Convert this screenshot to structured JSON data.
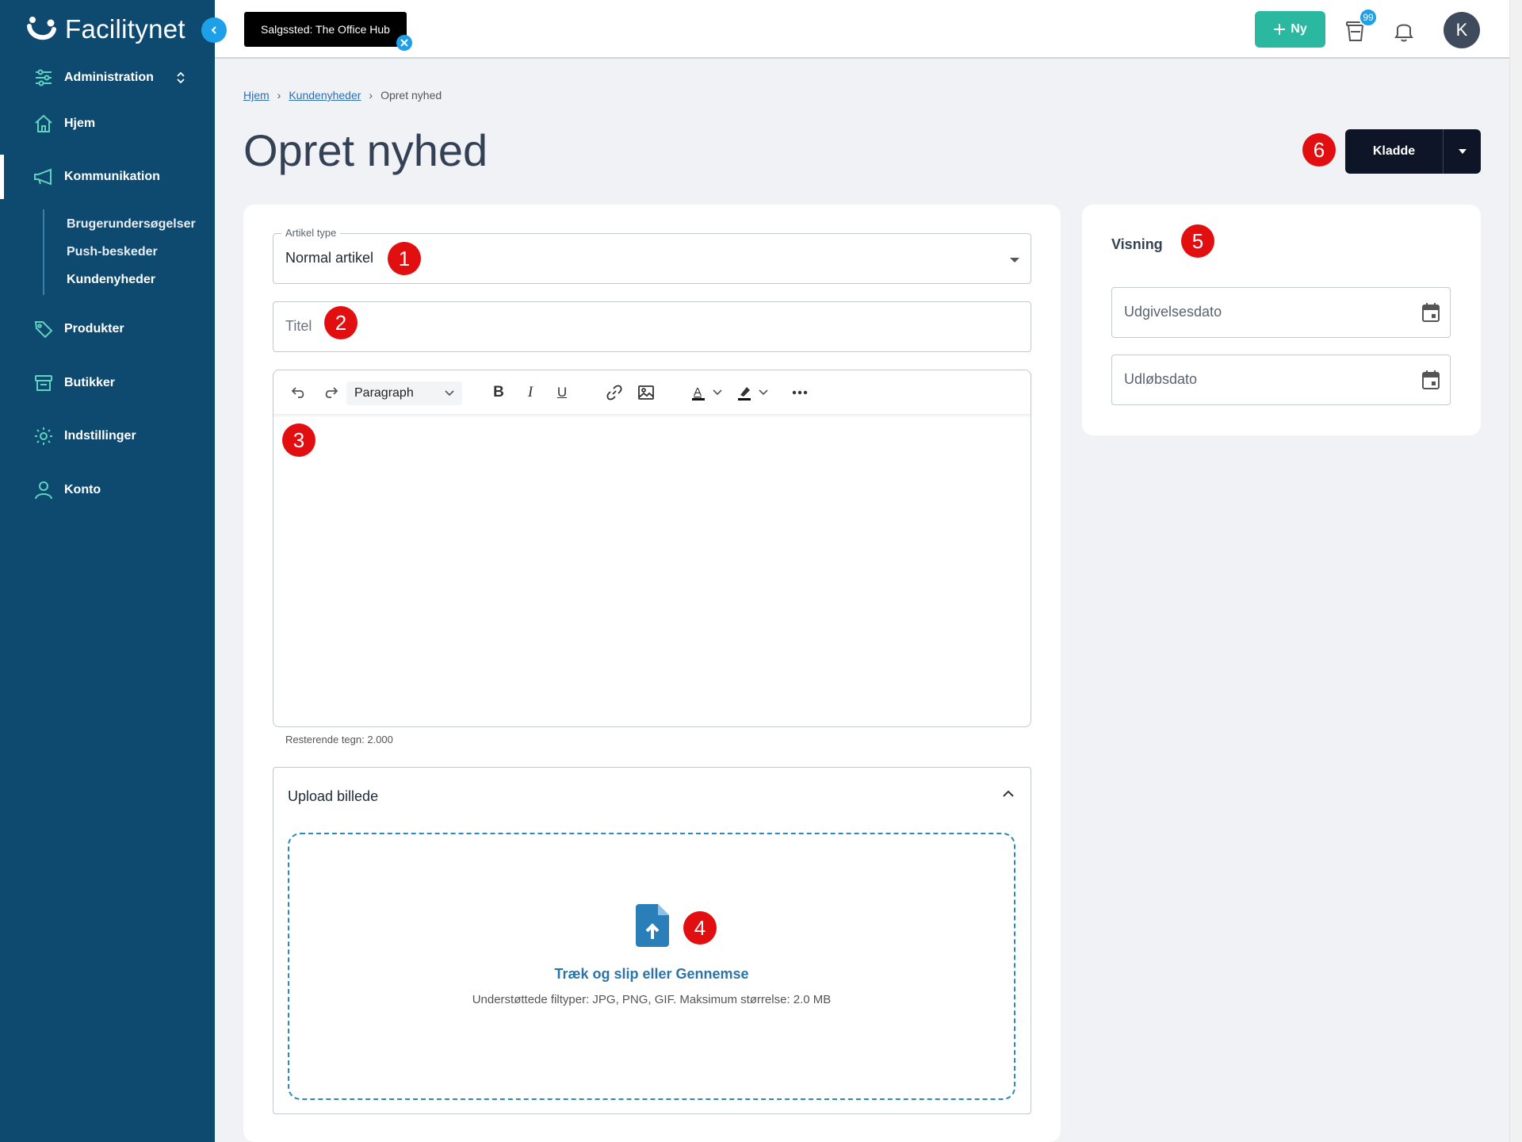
{
  "app": {
    "name": "Facilitynet"
  },
  "sidebar": {
    "items": [
      {
        "label": "Administration"
      },
      {
        "label": "Hjem"
      },
      {
        "label": "Kommunikation"
      },
      {
        "label": "Produkter"
      },
      {
        "label": "Butikker"
      },
      {
        "label": "Indstillinger"
      },
      {
        "label": "Konto"
      }
    ],
    "subitems": [
      {
        "label": "Brugerundersøgelser"
      },
      {
        "label": "Push-beskeder"
      },
      {
        "label": "Kundenyheder"
      }
    ]
  },
  "topbar": {
    "store_chip": "Salgssted: The Office Hub",
    "new_label": "Ny",
    "cart_count": "99",
    "avatar_initial": "K"
  },
  "breadcrumb": {
    "home": "Hjem",
    "section": "Kundenyheder",
    "current": "Opret nyhed"
  },
  "page": {
    "title": "Opret nyhed"
  },
  "actions": {
    "draft_label": "Kladde"
  },
  "form": {
    "article_type_label": "Artikel type",
    "article_type_value": "Normal artikel",
    "title_placeholder": "Titel",
    "editor_format": "Paragraph",
    "remaining_chars": "Resterende tegn: 2.000",
    "upload_title": "Upload billede",
    "upload_cta": "Træk og slip eller Gennemse",
    "upload_hint": "Understøttede filtyper: JPG, PNG, GIF. Maksimum størrelse: 2.0 MB"
  },
  "visibility": {
    "title": "Visning",
    "publish_date_placeholder": "Udgivelsesdato",
    "expiry_date_placeholder": "Udløbsdato"
  },
  "markers": [
    "1",
    "2",
    "3",
    "4",
    "5",
    "6"
  ],
  "colors": {
    "sidebar": "#0e4a70",
    "accent": "#2ab8a0",
    "marker": "#e10f0f",
    "primary_button": "#0d1526"
  }
}
